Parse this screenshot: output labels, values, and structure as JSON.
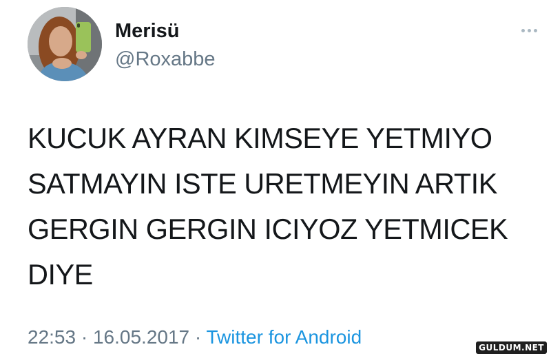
{
  "user": {
    "display_name": "Merisü",
    "handle": "@Roxabbe"
  },
  "tweet": {
    "text": "KUCUK AYRAN KIMSEYE YETMIYO\nSATMAYIN ISTE URETMEYIN ARTIK\nGERGIN GERGIN ICIYOZ YETMICEK\nDIYE",
    "time": "22:53",
    "separator": "·",
    "date": "16.05.2017",
    "source": "Twitter for Android"
  },
  "icons": {
    "more": "more-options-icon"
  },
  "watermark": {
    "text": "GULDUM.NET"
  },
  "colors": {
    "primary_text": "#14171a",
    "secondary_text": "#657786",
    "link": "#1b95e0"
  }
}
